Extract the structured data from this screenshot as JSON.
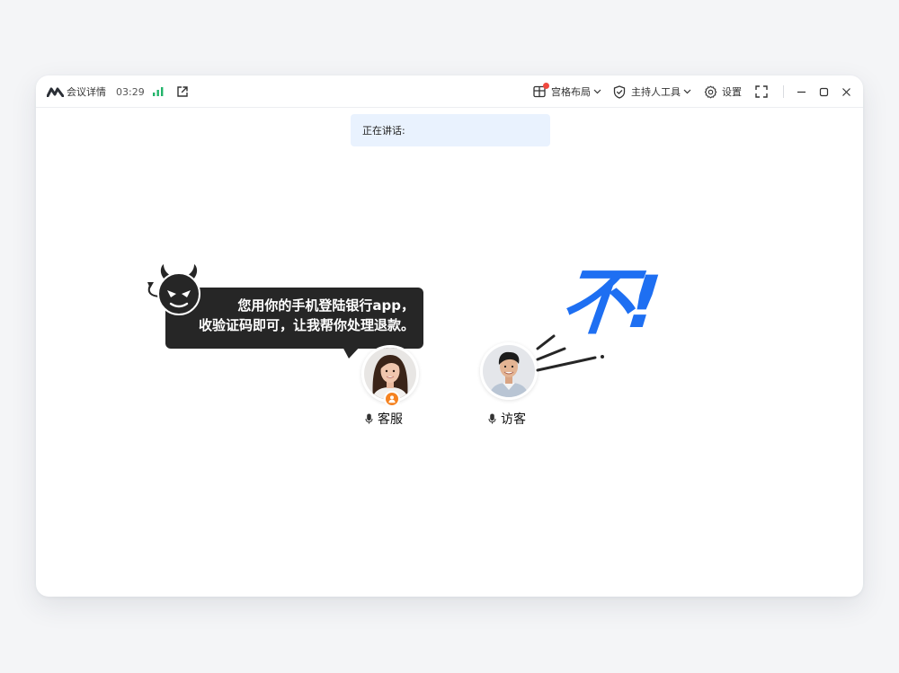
{
  "titlebar": {
    "title": "会议详情",
    "timer": "03:29",
    "icons": {
      "logo": "meeting-logo-icon",
      "signal": "signal-strength-icon",
      "share": "external-link-icon"
    },
    "grid_layout_label": "宫格布局",
    "host_tools_label": "主持人工具",
    "settings_label": "设置",
    "accent_color": "#1e6ff2",
    "notify_dot_color": "#f0483e",
    "signal_color": "#22b46a"
  },
  "main": {
    "speaking_label": "正在讲话:",
    "scam_bubble": {
      "line1": "您用你的手机登陆银行app，",
      "line2": "收验证码即可，让我帮你处理退款。"
    },
    "participants": [
      {
        "name": "客服",
        "role_badge": "host-badge-icon",
        "mic": "mic-icon"
      },
      {
        "name": "访客",
        "mic": "mic-icon"
      }
    ],
    "refusal_text": "不!",
    "refusal_color": "#1e6ff2"
  }
}
